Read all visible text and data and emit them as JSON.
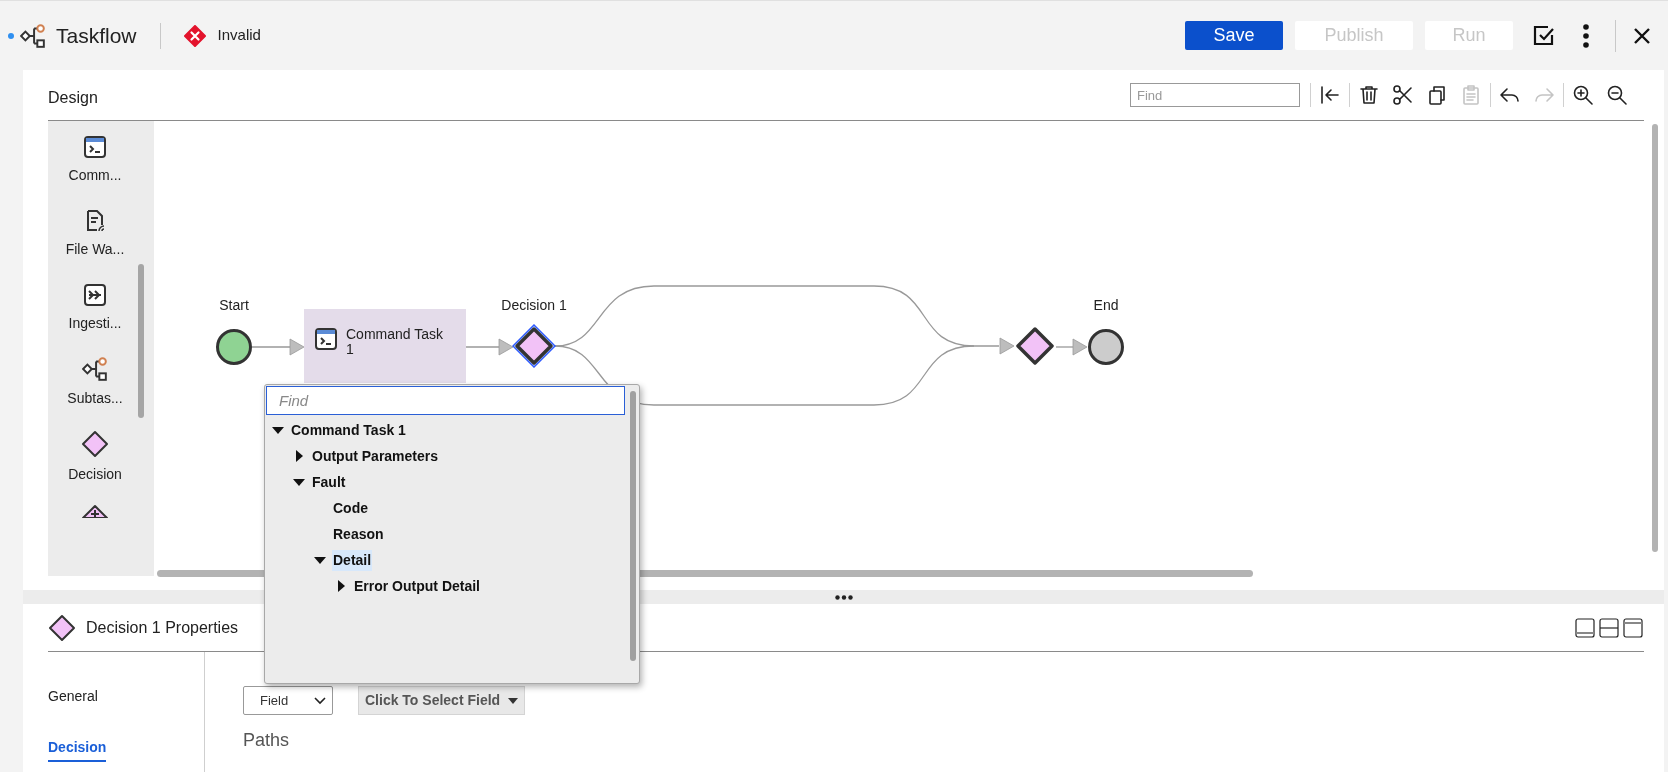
{
  "header": {
    "title": "Taskflow",
    "unsaved": true,
    "status": {
      "label": "Invalid",
      "valid": false
    },
    "buttons": [
      {
        "label": "Save",
        "kind": "primary",
        "disabled": false
      },
      {
        "label": "Publish",
        "kind": "secondary",
        "disabled": true
      },
      {
        "label": "Run",
        "kind": "secondary",
        "disabled": true
      }
    ]
  },
  "design": {
    "title": "Design",
    "find": {
      "placeholder": "Find"
    },
    "toolbar": [
      {
        "kind": "collapse",
        "disabled": false
      },
      {
        "kind": "delete",
        "disabled": false
      },
      {
        "kind": "cut",
        "disabled": false
      },
      {
        "kind": "copy",
        "disabled": false
      },
      {
        "kind": "paste",
        "disabled": true
      },
      {
        "kind": "undo",
        "disabled": false
      },
      {
        "kind": "redo",
        "disabled": true
      },
      {
        "kind": "zoom-in",
        "disabled": false
      },
      {
        "kind": "zoom-out",
        "disabled": false
      }
    ],
    "palette": [
      {
        "kind": "command",
        "label": "Comm..."
      },
      {
        "kind": "file-watch",
        "label": "File Wa..."
      },
      {
        "kind": "ingestion",
        "label": "Ingesti..."
      },
      {
        "kind": "subtask",
        "label": "Subtas..."
      },
      {
        "kind": "decision",
        "label": "Decision"
      },
      {
        "kind": "parallel"
      }
    ],
    "nodes": [
      {
        "kind": "start",
        "label": "Start",
        "selected": false
      },
      {
        "kind": "command",
        "label": "Command Task 1",
        "selected": false
      },
      {
        "kind": "decision",
        "label": "Decision 1",
        "selected": true
      },
      {
        "kind": "decision",
        "selected": false
      },
      {
        "kind": "end",
        "label": "End",
        "selected": false
      }
    ]
  },
  "field_picker": {
    "find": {
      "placeholder": "Find"
    },
    "tree": [
      {
        "label": "Command Task 1",
        "expanded": true,
        "selected": false,
        "children": [
          {
            "label": "Output Parameters",
            "expanded": false,
            "selected": false
          },
          {
            "label": "Fault",
            "expanded": true,
            "selected": false,
            "children": [
              {
                "label": "Code",
                "selected": false
              },
              {
                "label": "Reason",
                "selected": false
              },
              {
                "label": "Detail",
                "expanded": true,
                "selected": true,
                "children": [
                  {
                    "label": "Error Output Detail",
                    "expanded": false,
                    "selected": false
                  }
                ]
              }
            ]
          }
        ]
      }
    ]
  },
  "properties": {
    "title": "Decision 1 Properties",
    "tabs": [
      {
        "label": "General",
        "selected": false
      },
      {
        "label": "Decision",
        "selected": true
      }
    ],
    "field_type": {
      "value": "Field"
    },
    "field_select": {
      "value": "Click To Select Field"
    },
    "paths_label": "Paths"
  }
}
